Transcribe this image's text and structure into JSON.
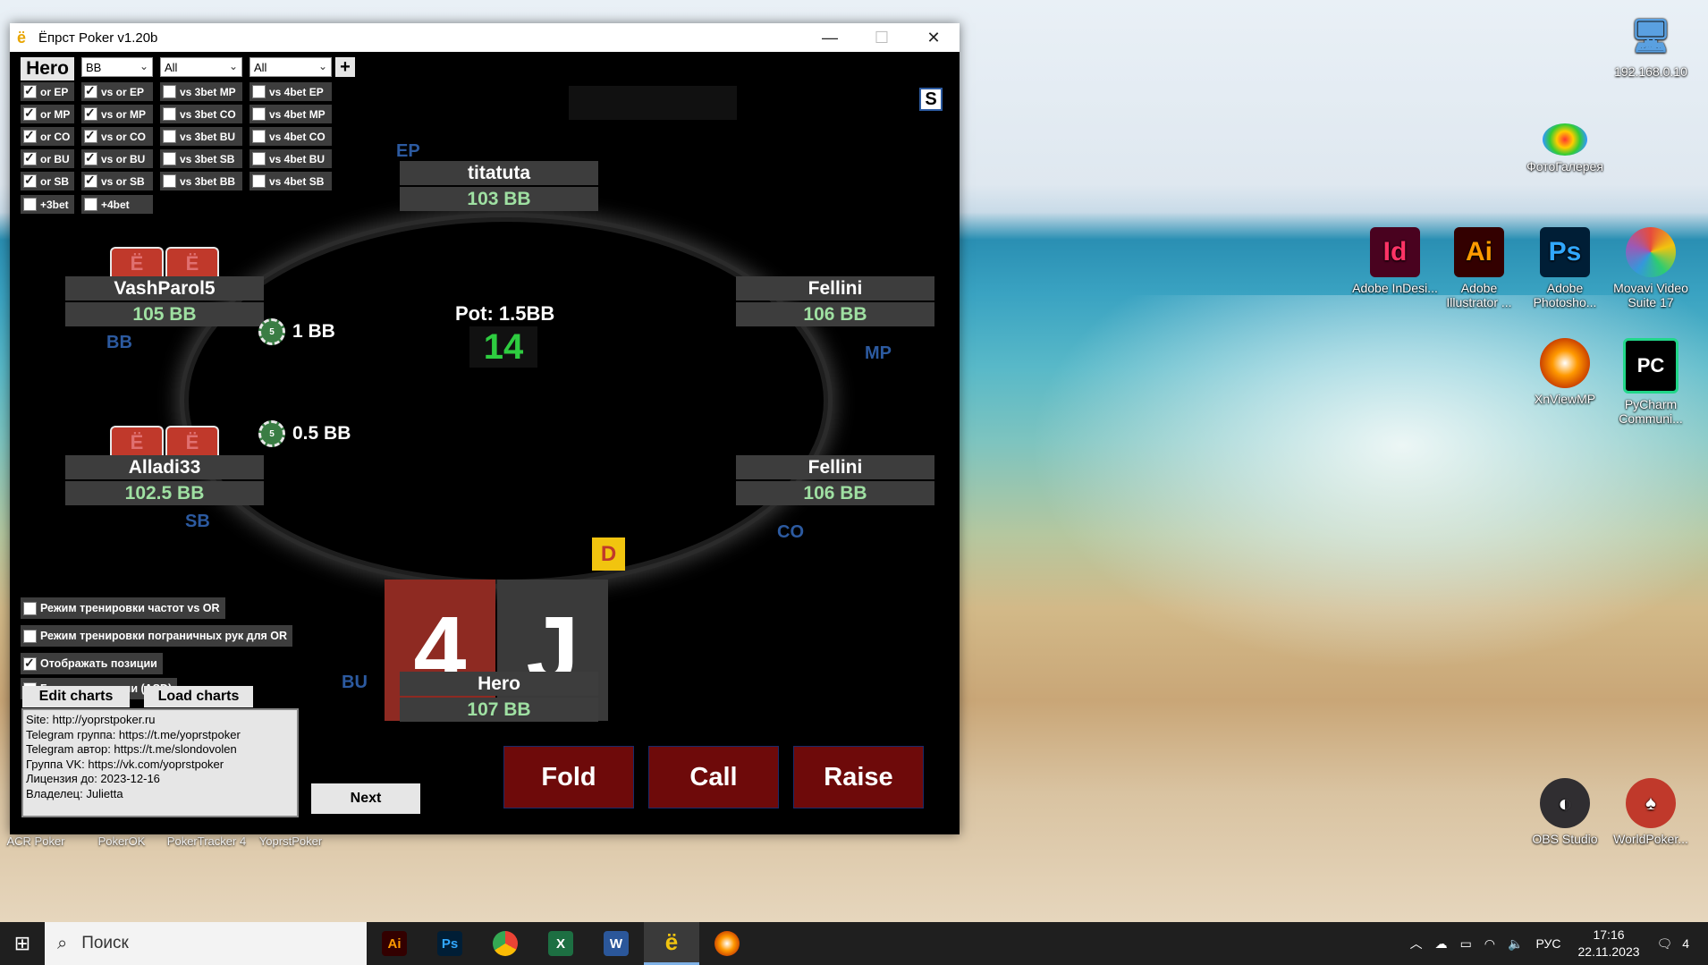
{
  "window": {
    "title": "Ёпрст Poker v1.20b",
    "minimize": "—",
    "maximize": "☐",
    "close": "✕"
  },
  "filters": {
    "hero_label": "Hero",
    "position_select": "BB",
    "select2": "All",
    "select3": "All",
    "plus": "+",
    "col1": [
      {
        "label": "or EP",
        "checked": true
      },
      {
        "label": "or MP",
        "checked": true
      },
      {
        "label": "or CO",
        "checked": true
      },
      {
        "label": "or BU",
        "checked": true
      },
      {
        "label": "or SB",
        "checked": true
      }
    ],
    "col2": [
      {
        "label": "vs or EP",
        "checked": true
      },
      {
        "label": "vs or MP",
        "checked": true
      },
      {
        "label": "vs or CO",
        "checked": true
      },
      {
        "label": "vs or BU",
        "checked": true
      },
      {
        "label": "vs or SB",
        "checked": true
      }
    ],
    "col3": [
      {
        "label": "vs 3bet MP",
        "checked": false
      },
      {
        "label": "vs 3bet CO",
        "checked": false
      },
      {
        "label": "vs 3bet BU",
        "checked": false
      },
      {
        "label": "vs 3bet SB",
        "checked": false
      },
      {
        "label": "vs 3bet BB",
        "checked": false
      }
    ],
    "col4": [
      {
        "label": "vs 4bet EP",
        "checked": false
      },
      {
        "label": "vs 4bet MP",
        "checked": false
      },
      {
        "label": "vs 4bet CO",
        "checked": false
      },
      {
        "label": "vs 4bet BU",
        "checked": false
      },
      {
        "label": "vs 4bet SB",
        "checked": false
      }
    ],
    "extra": [
      {
        "label": "+3bet",
        "checked": false
      },
      {
        "label": "+4bet",
        "checked": false
      }
    ],
    "s_button": "S"
  },
  "table": {
    "pot": "Pot: 1.5BB",
    "timer": "14",
    "dealer": "D",
    "seats": {
      "ep": {
        "name": "titatuta",
        "stack": "103 BB",
        "pos": "EP"
      },
      "mp": {
        "name": "Fellini",
        "stack": "106 BB",
        "pos": "MP"
      },
      "co": {
        "name": "Fellini",
        "stack": "106 BB",
        "pos": "CO"
      },
      "bu": {
        "name": "Hero",
        "stack": "107 BB",
        "pos": "BU"
      },
      "sb": {
        "name": "Alladi33",
        "stack": "102.5 BB",
        "pos": "SB"
      },
      "bb": {
        "name": "VashParol5",
        "stack": "105 BB",
        "pos": "BB"
      }
    },
    "bets": {
      "bb": "1 BB",
      "sb": "0.5 BB"
    },
    "chip_text": "5",
    "card_back_text": "Ё",
    "hero_cards": [
      {
        "rank": "4",
        "color": "#8e2a22"
      },
      {
        "rank": "J",
        "color": "#3a3a3a"
      }
    ]
  },
  "actions": {
    "fold": "Fold",
    "call": "Call",
    "raise": "Raise",
    "next": "Next"
  },
  "options": [
    {
      "label": "Режим тренировки частот vs OR",
      "checked": false
    },
    {
      "label": "Режим тренировки пограничных рук для OR",
      "checked": false
    },
    {
      "label": "Отображать позиции",
      "checked": true
    },
    {
      "label": "Горячие клавиши (ASD)",
      "checked": false
    }
  ],
  "buttons": {
    "edit_charts": "Edit charts",
    "load_charts": "Load charts"
  },
  "info": [
    "Site: http://yoprstpoker.ru",
    "Telegram группа: https://t.me/yoprstpoker",
    "Telegram автор: https://t.me/slondovolen",
    "Группа VK: https://vk.com/yoprstpoker",
    "Лицензия до: 2023-12-16",
    "Владелец: Julietta"
  ],
  "desktop_icons": {
    "ip": "192.168.0.10",
    "photo": "ФотоГалерея",
    "indesign": "Adobe InDesi...",
    "illustrator": "Adobe Illustrator ...",
    "photoshop": "Adobe Photosho...",
    "movavi": "Movavi Video Suite 17",
    "xnview": "XnViewMP",
    "pycharm": "PyCharm Communi...",
    "obs": "OBS Studio",
    "worldpoker": "WorldPoker...",
    "acr": "ACR Poker",
    "pokerok": "PokerOK",
    "pokertracker": "PokerTracker 4",
    "yoprst": "YoprstPoker"
  },
  "taskbar": {
    "search_placeholder": "Поиск",
    "lang": "РУС",
    "time": "17:16",
    "date": "22.11.2023",
    "notif": "4"
  }
}
